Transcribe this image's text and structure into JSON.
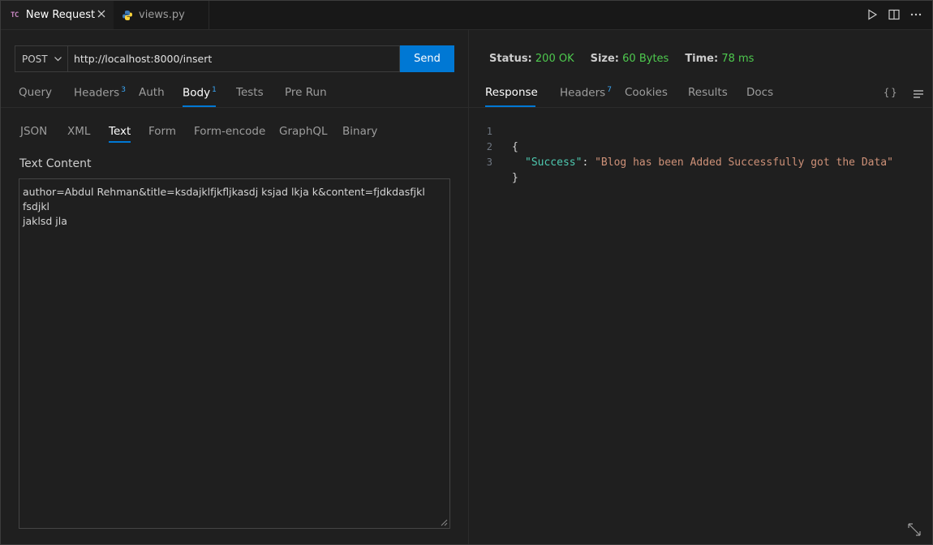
{
  "tabs": [
    {
      "logo": "TC",
      "label": "New Request",
      "icon": "thunder-client-icon"
    },
    {
      "label": "views.py",
      "icon": "python-icon"
    }
  ],
  "request": {
    "method": "POST",
    "url": "http://localhost:8000/insert",
    "send_label": "Send",
    "tabs": [
      {
        "label": "Query"
      },
      {
        "label": "Headers",
        "badge": "3"
      },
      {
        "label": "Auth"
      },
      {
        "label": "Body",
        "badge": "1",
        "active": true
      },
      {
        "label": "Tests"
      },
      {
        "label": "Pre Run"
      }
    ],
    "body_tabs": [
      {
        "label": "JSON"
      },
      {
        "label": "XML"
      },
      {
        "label": "Text",
        "active": true
      },
      {
        "label": "Form"
      },
      {
        "label": "Form-encode"
      },
      {
        "label": "GraphQL"
      },
      {
        "label": "Binary"
      }
    ],
    "text_content_label": "Text Content",
    "text_content_line1": "author=Abdul Rehman&title=ksdajklfjkfljkasdj ksjad lkja k&content=fjdkdasfjkl fsdjkl",
    "text_content_line2": "jaklsd jla"
  },
  "response": {
    "status_label": "Status:",
    "status_value": "200 OK",
    "size_label": "Size:",
    "size_value": "60 Bytes",
    "time_label": "Time:",
    "time_value": "78 ms",
    "tabs": [
      {
        "label": "Response",
        "active": true
      },
      {
        "label": "Headers",
        "badge": "7"
      },
      {
        "label": "Cookies"
      },
      {
        "label": "Results"
      },
      {
        "label": "Docs"
      }
    ],
    "format_icon_text": "{}",
    "code": {
      "line_numbers": [
        "1",
        "2",
        "3"
      ],
      "open_brace": "{",
      "key": "\"Success\"",
      "colon": ": ",
      "value": "\"Blog has been Added Successfully got the Data\"",
      "close_brace": "}"
    }
  },
  "colors": {
    "accent": "#0078d4",
    "status_green": "#4ec94e",
    "json_key": "#4ec9b0",
    "json_string": "#ce9178"
  }
}
